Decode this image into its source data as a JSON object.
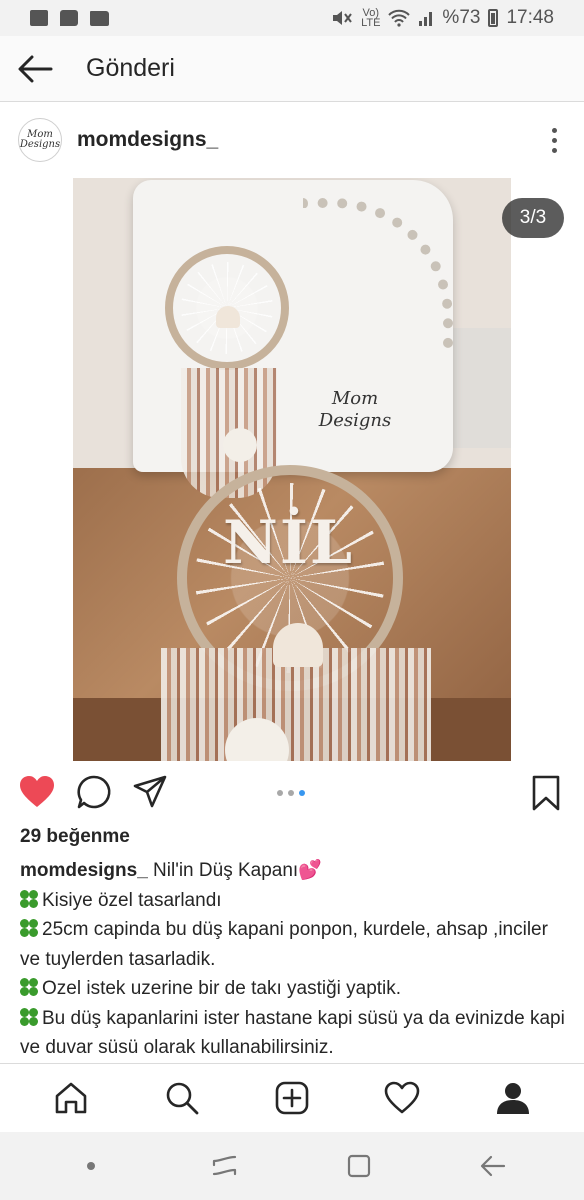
{
  "status_bar": {
    "battery": "%73",
    "time": "17:48",
    "volte_top": "Vo)",
    "volte_bottom": "LTE"
  },
  "header": {
    "title": "Gönderi"
  },
  "post": {
    "username": "momdesigns_",
    "avatar_text": "Mom Designs",
    "page_counter": "3/3",
    "image_watermark": "Mom Designs",
    "image_letters": "NİL",
    "likes": "29 beğenme",
    "caption": {
      "username": "momdesigns_",
      "title": "Nil'in Düş Kapanı",
      "lines": [
        "Kisiye özel tasarlandı",
        "25cm capinda bu düş kapani ponpon, kurdele, ahsap ,inciler ve tuylerden tasarladik.",
        "Ozel istek uzerine bir de takı yastiği yaptik.",
        "Bu düş kapanlarini ister hastane kapi süsü ya da evinizde kapi ve duvar süsü olarak kullanabilirsiniz."
      ]
    }
  },
  "carousel": {
    "count": 3,
    "active_index": 2
  },
  "icons": {
    "like": "heart-filled-icon",
    "comment": "comment-bubble-icon",
    "share": "paper-plane-icon",
    "save": "bookmark-icon",
    "nav": [
      "home-icon",
      "search-icon",
      "add-post-icon",
      "activity-heart-icon",
      "profile-icon"
    ],
    "system": [
      "dot-icon",
      "recent-apps-icon",
      "home-square-icon",
      "back-arrow-icon"
    ]
  },
  "colors": {
    "like_red": "#ed4956",
    "carousel_active": "#3897f0",
    "text": "#262626"
  }
}
